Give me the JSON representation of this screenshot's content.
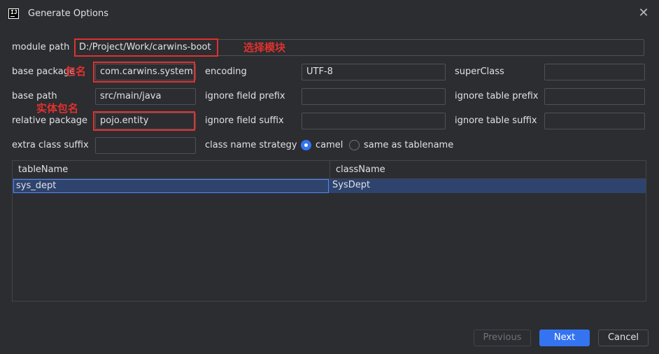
{
  "window": {
    "title": "Generate Options",
    "logo_text": "IJ"
  },
  "form": {
    "module_path": {
      "label": "module path",
      "value": "D:/Project/Work/carwins-boot"
    },
    "base_package": {
      "label": "base package",
      "value": "com.carwins.system"
    },
    "encoding": {
      "label": "encoding",
      "value": "UTF-8"
    },
    "super_class": {
      "label": "superClass",
      "value": ""
    },
    "base_path": {
      "label": "base path",
      "value": "src/main/java"
    },
    "ignore_field_prefix": {
      "label": "ignore field prefix",
      "value": ""
    },
    "ignore_table_prefix": {
      "label": "ignore table prefix",
      "value": ""
    },
    "relative_package": {
      "label": "relative package",
      "value": "pojo.entity"
    },
    "ignore_field_suffix": {
      "label": "ignore field suffix",
      "value": ""
    },
    "ignore_table_suffix": {
      "label": "ignore table suffix",
      "value": ""
    },
    "extra_class_suffix": {
      "label": "extra class suffix",
      "value": ""
    },
    "class_name_strategy": {
      "label": "class name strategy",
      "options": [
        "camel",
        "same as tablename"
      ],
      "selected": "camel"
    }
  },
  "annotations": {
    "select_module": "选择模块",
    "package_name": "包名",
    "entity_package_name": "实体包名",
    "color": "#e0312f"
  },
  "table": {
    "columns": [
      "tableName",
      "className"
    ],
    "rows": [
      {
        "tableName": "sys_dept",
        "className": "SysDept"
      }
    ]
  },
  "buttons": {
    "previous": "Previous",
    "next": "Next",
    "cancel": "Cancel"
  },
  "colors": {
    "background": "#2b2d30",
    "accent": "#3574f0",
    "selection": "#2e436e"
  }
}
